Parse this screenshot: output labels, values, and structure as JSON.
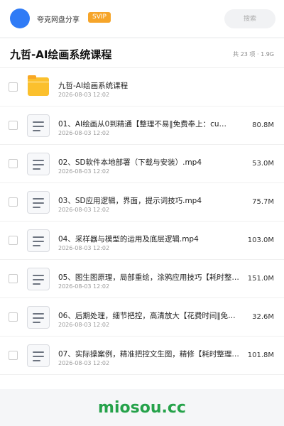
{
  "header": {
    "sharer_name": "夸克网盘分享",
    "badge": "SVIP",
    "search_placeholder": "搜索"
  },
  "folder": {
    "title": "九哲-AI绘画系统课程",
    "meta": "共 23 项 · 1.9G"
  },
  "files": [
    {
      "type": "folder",
      "name": "九哲-AI绘画系统课程",
      "date": "2026-08-03 12:02",
      "size": ""
    },
    {
      "type": "video",
      "name": "01、AI绘画从0到精通【整理不易‖免费奉上：cu…",
      "date": "2026-08-03 12:02",
      "size": "80.8M"
    },
    {
      "type": "video",
      "name": "02、SD软件本地部署（下载与安装）.mp4",
      "date": "2026-08-03 12:02",
      "size": "53.0M"
    },
    {
      "type": "video",
      "name": "03、SD应用逻辑，界面，提示词技巧.mp4",
      "date": "2026-08-03 12:02",
      "size": "75.7M"
    },
    {
      "type": "video",
      "name": "04、采样器与模型的运用及底层逻辑.mp4",
      "date": "2026-08-03 12:02",
      "size": "103.0M"
    },
    {
      "type": "video",
      "name": "05、图生图原理，局部重绘，涂鸦应用技巧【耗时整理…",
      "date": "2026-08-03 12:02",
      "size": "151.0M"
    },
    {
      "type": "video",
      "name": "06、后期处理，细节把控，高清放大【花费时间‖免费…",
      "date": "2026-08-03 12:02",
      "size": "32.6M"
    },
    {
      "type": "video",
      "name": "07、实际操案例，精准把控文生图，精修【耗时整理‖…",
      "date": "2026-08-03 12:02",
      "size": "101.8M"
    }
  ],
  "watermark": "miosou.cc",
  "colors": {
    "accent": "#2f7bf6",
    "svip": "#f6a52a",
    "folder": "#fbc02d",
    "watermark": "#25a24a"
  },
  "icons": {
    "avatar": "avatar-circle",
    "folder": "folder-icon",
    "file": "document-icon"
  }
}
